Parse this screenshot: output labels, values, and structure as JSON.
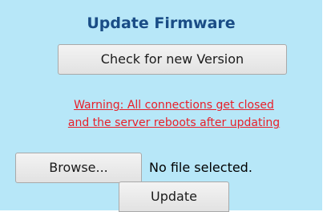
{
  "title": "Update Firmware",
  "check_button_label": "Check for new Version",
  "warning": {
    "line1": "Warning: All connections get closed",
    "line2": "and the server reboots after updating"
  },
  "file_input": {
    "browse_label": "Browse...",
    "status": "No file selected."
  },
  "update_button_label": "Update",
  "colors": {
    "background": "#b7e7f8",
    "title": "#1a4d86",
    "warning": "#e8202a"
  }
}
